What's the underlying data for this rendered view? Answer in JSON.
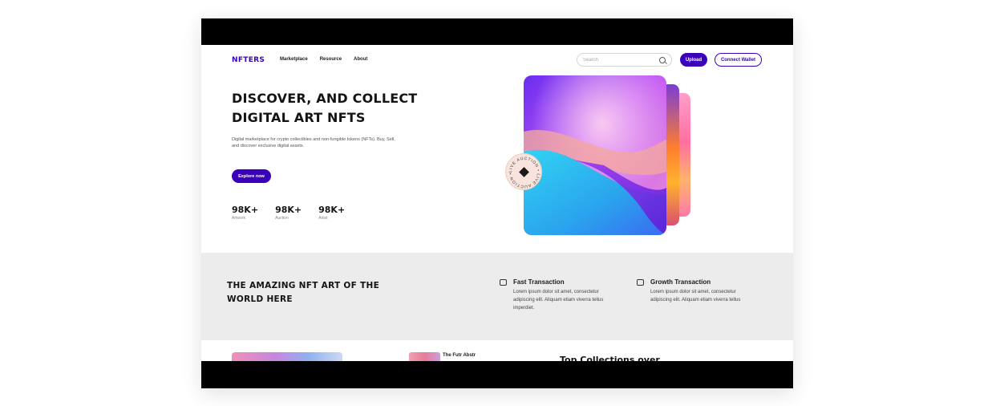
{
  "nav": {
    "logo": "NFTERS",
    "links": [
      "Marketplace",
      "Resource",
      "About"
    ],
    "search_placeholder": "Search",
    "upload_label": "Upload",
    "wallet_label": "Connect Wallet"
  },
  "hero": {
    "title": "DISCOVER, AND COLLECT DIGITAL ART NFTS",
    "subtitle": "Digital marketplace for crypto collectibles and non-fungible tokens (NFTs). Buy, Sell, and discover exclusive digital assets.",
    "cta_label": "Explore now",
    "stats": [
      {
        "value": "98K+",
        "label": "Artwork"
      },
      {
        "value": "98K+",
        "label": "Auction"
      },
      {
        "value": "98K+",
        "label": "Artist"
      }
    ],
    "badge_text": "LIVE AUCTION • LIVE AUCTION •"
  },
  "features": {
    "title": "THE AMAZING NFT ART OF THE WORLD HERE",
    "items": [
      {
        "icon": "card-icon",
        "title": "Fast Transaction",
        "desc": "Lorem ipsum dolor sit amet, consectetur adipiscing elit. Aliquam etiam viverra tellus imperdiet."
      },
      {
        "icon": "chart-icon",
        "title": "Growth Transaction",
        "desc": "Lorem ipsum dolor sit amet, consectetur adipiscing elit. Aliquam etiam viverra tellus"
      }
    ]
  },
  "collections": {
    "card_label": "The Futr Abstr",
    "heading": "Top Collections over"
  },
  "colors": {
    "brand": "#3b00b9",
    "section_bg": "#ececec"
  }
}
